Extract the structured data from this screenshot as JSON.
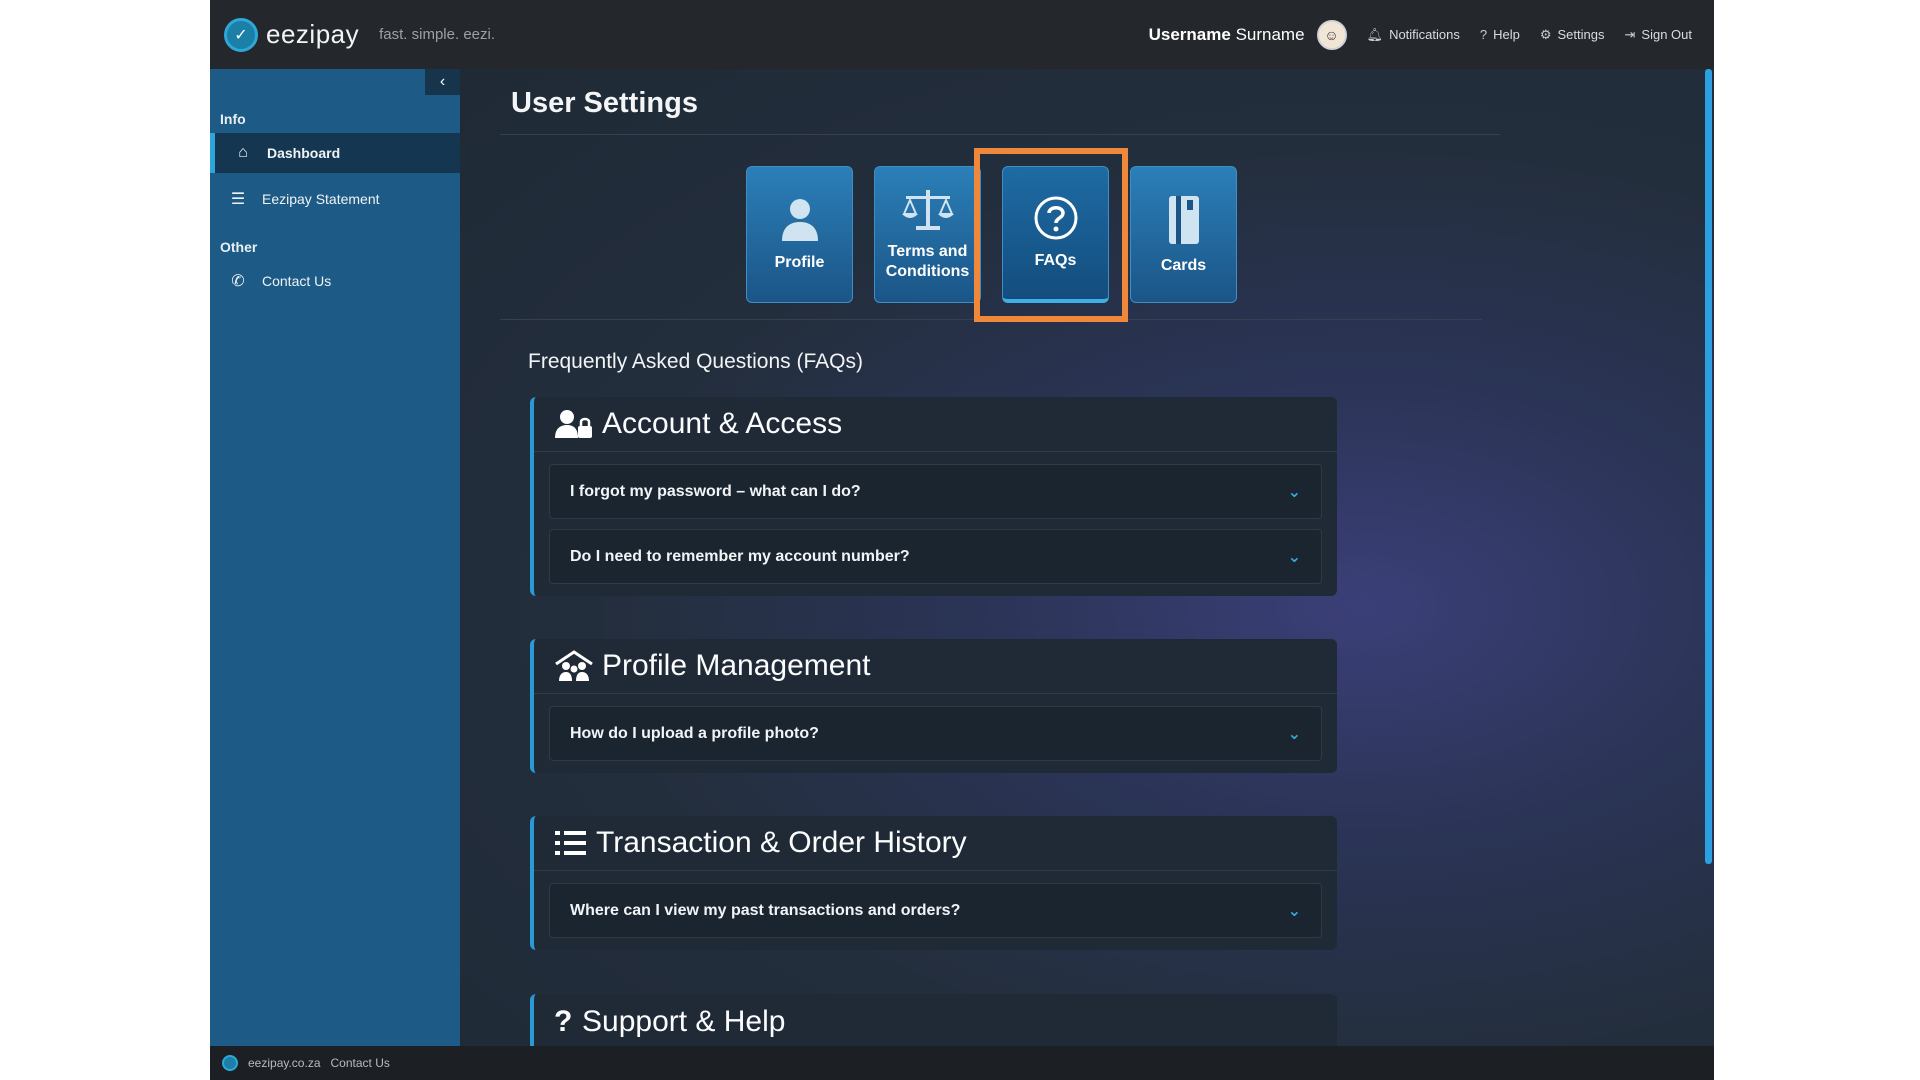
{
  "header": {
    "brand": "eezipay",
    "tagline": "fast. simple. eezi.",
    "user_first": "Username",
    "user_last": "Surname",
    "links": {
      "notifications": "Notifications",
      "help": "Help",
      "settings": "Settings",
      "sign_out": "Sign Out"
    }
  },
  "sidebar": {
    "section_info": "Info",
    "section_other": "Other",
    "items": [
      {
        "label": "Dashboard",
        "icon": "home-icon",
        "active": true
      },
      {
        "label": "Eezipay Statement",
        "icon": "list-icon",
        "active": false
      },
      {
        "label": "Contact Us",
        "icon": "phone-icon",
        "active": false
      }
    ]
  },
  "main": {
    "title": "User Settings",
    "tiles": [
      {
        "label": "Profile",
        "icon": "user-icon"
      },
      {
        "label": "Terms and Conditions",
        "icon": "scales-icon"
      },
      {
        "label": "FAQs",
        "icon": "question-circle-icon",
        "selected": true
      },
      {
        "label": "Cards",
        "icon": "card-icon"
      }
    ],
    "faq_heading": "Frequently Asked Questions (FAQs)",
    "groups": [
      {
        "title": "Account & Access",
        "icon": "user-lock-icon",
        "questions": [
          "I forgot my password – what can I do?",
          "Do I need to remember my account number?"
        ]
      },
      {
        "title": "Profile Management",
        "icon": "people-roof-icon",
        "questions": [
          "How do I upload a profile photo?"
        ]
      },
      {
        "title": "Transaction & Order History",
        "icon": "list-icon",
        "questions": [
          "Where can I view my past transactions and orders?"
        ]
      },
      {
        "title": "Support & Help",
        "icon": "question-icon",
        "questions": []
      }
    ]
  },
  "footer": {
    "domain": "eezipay.co.za",
    "contact": "Contact Us"
  },
  "colors": {
    "accent": "#2a9ad6",
    "sidebar": "#1d5a85",
    "highlight": "#f0883c",
    "topbar": "#24272b"
  }
}
